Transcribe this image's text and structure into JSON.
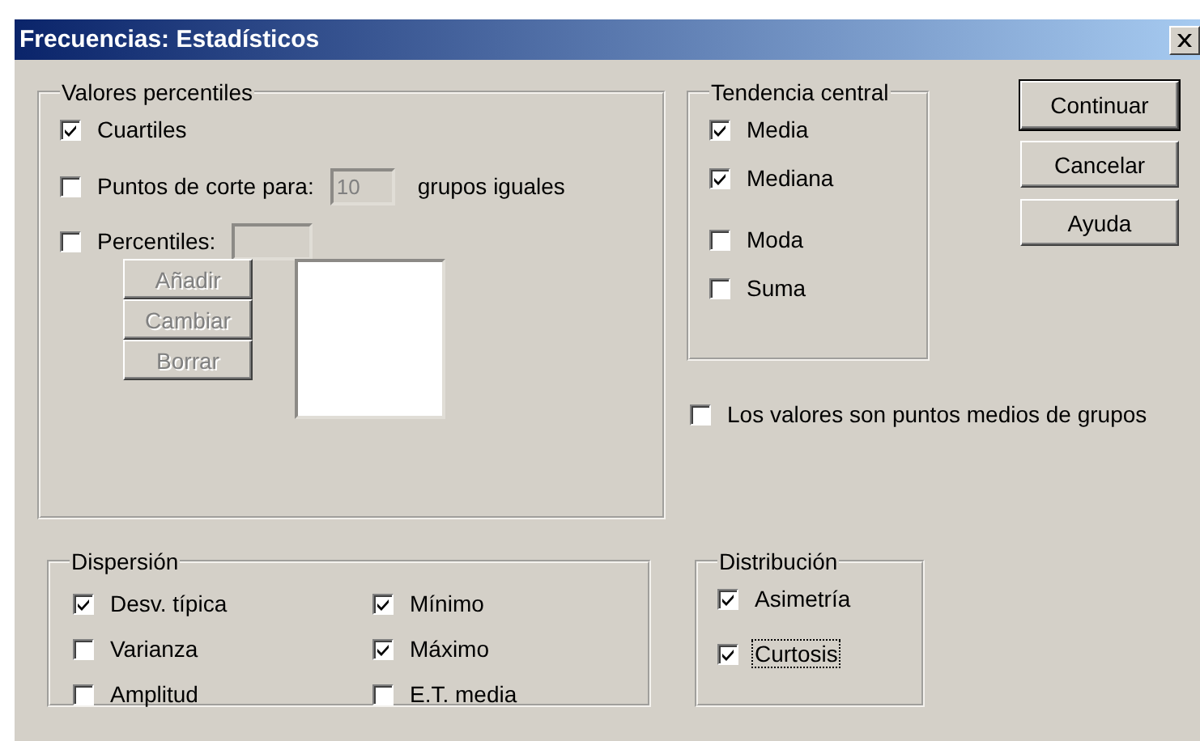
{
  "window": {
    "title": "Frecuencias: Estadísticos"
  },
  "percentile_values": {
    "title": "Valores percentiles",
    "options": [
      {
        "kind": "plain",
        "label": "Cuartiles",
        "checked": true
      },
      {
        "kind": "cut",
        "label": "Puntos de corte para:",
        "checked": false,
        "value": "10",
        "suffix": "grupos iguales"
      },
      {
        "kind": "input",
        "label": "Percentiles:",
        "checked": false
      }
    ],
    "buttons": [
      {
        "label": "Añadir",
        "disabled": true
      },
      {
        "label": "Cambiar",
        "disabled": true
      },
      {
        "label": "Borrar",
        "disabled": true
      }
    ]
  },
  "central_tendency": {
    "title": "Tendencia central",
    "items": [
      {
        "label": "Media",
        "checked": true
      },
      {
        "label": "Mediana",
        "checked": true
      },
      {
        "label": "Moda",
        "checked": false
      },
      {
        "label": "Suma",
        "checked": false
      }
    ]
  },
  "midpoints": {
    "label": "Los valores son puntos medios de grupos",
    "checked": false
  },
  "buttons": [
    {
      "label": "Continuar",
      "default": true
    },
    {
      "label": "Cancelar",
      "default": false
    },
    {
      "label": "Ayuda",
      "default": false
    }
  ],
  "dispersion": {
    "title": "Dispersión",
    "items": [
      {
        "label": "Desv. típica",
        "checked": true
      },
      {
        "label": "Varianza",
        "checked": false
      },
      {
        "label": "Amplitud",
        "checked": false
      },
      {
        "label": "Mínimo",
        "checked": true
      },
      {
        "label": "Máximo",
        "checked": true
      },
      {
        "label": "E.T. media",
        "checked": false
      }
    ]
  },
  "distribution": {
    "title": "Distribución",
    "items": [
      {
        "label": "Asimetría",
        "checked": true,
        "focused": false
      },
      {
        "label": "Curtosis",
        "checked": true,
        "focused": true
      }
    ]
  }
}
